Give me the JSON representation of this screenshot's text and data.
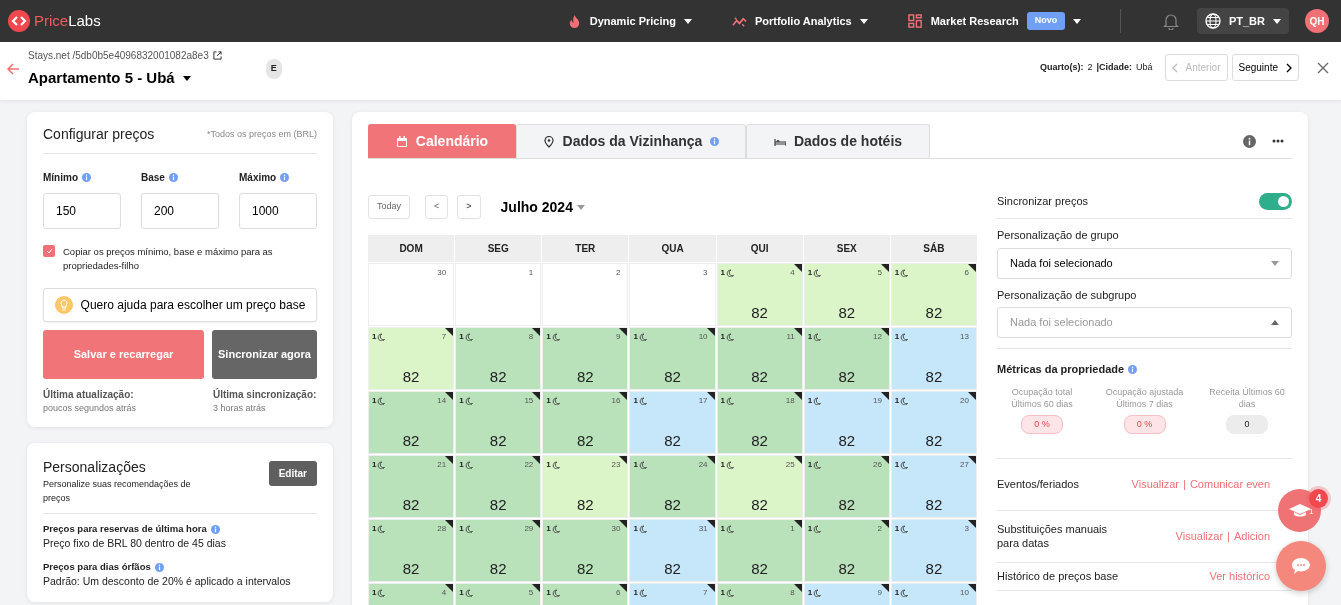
{
  "brand": {
    "accent": "Price",
    "rest": "Labs"
  },
  "nav": [
    {
      "label": "Dynamic Pricing"
    },
    {
      "label": "Portfolio Analytics"
    },
    {
      "label": "Market Research",
      "badge": "Novo"
    }
  ],
  "locale": "PT_BR",
  "avatar": "QH",
  "header": {
    "breadcrumb": "Stays.net /5db0b5e4096832001082a8e3",
    "title": "Apartamento 5 - Ubá",
    "tag": "E",
    "info": [
      {
        "label": "Quarto(s):",
        "value": "2"
      },
      {
        "label": "|Cidade:",
        "value": "Ubá"
      }
    ],
    "pager": [
      {
        "label": "Anterior",
        "disabled": true
      },
      {
        "label": "Seguinte",
        "disabled": false
      }
    ]
  },
  "prices": {
    "title": "Configurar preços",
    "note": "*Todos os preços em (BRL)",
    "fields": [
      {
        "label": "Mínimo",
        "value": "150"
      },
      {
        "label": "Base",
        "value": "200"
      },
      {
        "label": "Máximo",
        "value": "1000"
      }
    ],
    "copy": {
      "label": "Copiar os preços mínimo, base e máximo para as propriedades-filho",
      "checked": true
    },
    "help": "Quero ajuda para escolher um preço base",
    "save": "Salvar e recarregar",
    "sync": "Sincronizar agora",
    "statuses": [
      {
        "label": "Última atualização:",
        "value": "poucos segundos atrás"
      },
      {
        "label": "Última sincronização:",
        "value": "3 horas atrás"
      }
    ]
  },
  "custom": {
    "title": "Personalizações",
    "subtitle": "Personalize suas recomendações de preços",
    "edit": "Editar",
    "items": [
      {
        "label": "Preços para reservas de última hora",
        "value": "Preço fixo de BRL 80 dentro de 45 dias"
      },
      {
        "label": "Preços para dias órfãos",
        "value": "Padrão: Um desconto de 20% é aplicado a intervalos"
      }
    ]
  },
  "tabs": [
    {
      "label": "Calendário",
      "selected": true
    },
    {
      "label": "Dados da Vizinhança",
      "selected": false,
      "info": true
    },
    {
      "label": "Dados de hotéis",
      "selected": false
    }
  ],
  "calendar": {
    "today": "Today",
    "prev": "<",
    "next": ">",
    "month": "Julho 2024",
    "weekdays": [
      "DOM",
      "SEG",
      "TER",
      "QUA",
      "QUI",
      "SEX",
      "SÁB"
    ],
    "weeks": [
      [
        {
          "date": "30",
          "color": "#ffffff"
        },
        {
          "date": "1",
          "color": "#ffffff"
        },
        {
          "date": "2",
          "color": "#ffffff"
        },
        {
          "date": "3",
          "color": "#ffffff"
        },
        {
          "date": "4",
          "nights": "1",
          "price": "82",
          "color": "#dcf5c8",
          "flag": true
        },
        {
          "date": "5",
          "nights": "1",
          "price": "82",
          "color": "#dcf5c8",
          "flag": true
        },
        {
          "date": "6",
          "nights": "1",
          "price": "82",
          "color": "#dcf5c8",
          "flag": true
        }
      ],
      [
        {
          "date": "7",
          "nights": "1",
          "price": "82",
          "color": "#dcf5c8",
          "flag": true
        },
        {
          "date": "8",
          "nights": "1",
          "price": "82",
          "color": "#b9e2bb",
          "flag": true
        },
        {
          "date": "9",
          "nights": "1",
          "price": "82",
          "color": "#b9e2bb",
          "flag": true
        },
        {
          "date": "10",
          "nights": "1",
          "price": "82",
          "color": "#b9e2bb",
          "flag": true
        },
        {
          "date": "11",
          "nights": "1",
          "price": "82",
          "color": "#b9e2bb",
          "flag": true
        },
        {
          "date": "12",
          "nights": "1",
          "price": "82",
          "color": "#b9e2bb",
          "flag": true
        },
        {
          "date": "13",
          "nights": "1",
          "price": "82",
          "color": "#c6e6f9",
          "flag": false
        }
      ],
      [
        {
          "date": "14",
          "nights": "1",
          "price": "82",
          "color": "#b9e2bb",
          "flag": true
        },
        {
          "date": "15",
          "nights": "1",
          "price": "82",
          "color": "#b9e2bb",
          "flag": true
        },
        {
          "date": "16",
          "nights": "1",
          "price": "82",
          "color": "#b9e2bb",
          "flag": true
        },
        {
          "date": "17",
          "nights": "1",
          "price": "82",
          "color": "#c6e6f9",
          "flag": true
        },
        {
          "date": "18",
          "nights": "1",
          "price": "82",
          "color": "#b9e2bb",
          "flag": true
        },
        {
          "date": "19",
          "nights": "1",
          "price": "82",
          "color": "#c6e6f9",
          "flag": true
        },
        {
          "date": "20",
          "nights": "1",
          "price": "82",
          "color": "#c6e6f9",
          "flag": true
        }
      ],
      [
        {
          "date": "21",
          "nights": "1",
          "price": "82",
          "color": "#b9e2bb",
          "flag": true
        },
        {
          "date": "22",
          "nights": "1",
          "price": "82",
          "color": "#b9e2bb",
          "flag": true
        },
        {
          "date": "23",
          "nights": "1",
          "price": "82",
          "color": "#dcf5c8",
          "flag": true
        },
        {
          "date": "24",
          "nights": "1",
          "price": "82",
          "color": "#b9e2bb",
          "flag": true
        },
        {
          "date": "25",
          "nights": "1",
          "price": "82",
          "color": "#dcf5c8",
          "flag": true
        },
        {
          "date": "26",
          "nights": "1",
          "price": "82",
          "color": "#b9e2bb",
          "flag": true
        },
        {
          "date": "27",
          "nights": "1",
          "price": "82",
          "color": "#c6e6f9",
          "flag": true
        }
      ],
      [
        {
          "date": "28",
          "nights": "1",
          "price": "82",
          "color": "#b9e2bb",
          "flag": true
        },
        {
          "date": "29",
          "nights": "1",
          "price": "82",
          "color": "#b9e2bb",
          "flag": true
        },
        {
          "date": "30",
          "nights": "1",
          "price": "82",
          "color": "#b9e2bb",
          "flag": true
        },
        {
          "date": "31",
          "nights": "1",
          "price": "82",
          "color": "#c6e6f9",
          "flag": true
        },
        {
          "date": "1",
          "nights": "1",
          "price": "82",
          "color": "#b9e2bb",
          "flag": true
        },
        {
          "date": "2",
          "nights": "1",
          "price": "82",
          "color": "#b9e2bb",
          "flag": true
        },
        {
          "date": "3",
          "nights": "1",
          "price": "82",
          "color": "#c6e6f9",
          "flag": true
        }
      ],
      [
        {
          "date": "4",
          "nights": "1",
          "color": "#b9e2bb",
          "flag": true
        },
        {
          "date": "5",
          "nights": "1",
          "color": "#b9e2bb",
          "flag": true
        },
        {
          "date": "6",
          "nights": "1",
          "color": "#b9e2bb",
          "flag": true
        },
        {
          "date": "7",
          "nights": "1",
          "color": "#c6e6f9",
          "flag": true
        },
        {
          "date": "8",
          "nights": "1",
          "color": "#b9e2bb",
          "flag": true
        },
        {
          "date": "9",
          "nights": "1",
          "color": "#c6e6f9",
          "flag": true
        },
        {
          "date": "10",
          "nights": "1",
          "color": "#c6e6f9",
          "flag": true
        }
      ]
    ]
  },
  "side": {
    "sync": {
      "label": "Sincronizar preços",
      "on": true
    },
    "group": {
      "label": "Personalização de grupo",
      "value": "Nada foi selecionado"
    },
    "subgroup": {
      "label": "Personalização de subgrupo",
      "placeholder": "Nada foi selecionado"
    },
    "metrics": {
      "title": "Métricas da propriedade",
      "items": [
        {
          "label": "Ocupação total Últimos 60 dias",
          "value": "0 %",
          "kind": "alert"
        },
        {
          "label": "Ocupação ajustada Últimos 7 dias",
          "value": "0 %",
          "kind": "alert"
        },
        {
          "label": "Receita Últimos 60 dias",
          "value": "0",
          "kind": "plain"
        }
      ]
    },
    "rows": [
      {
        "label": "Eventos/feriados",
        "links": [
          "Visualizar",
          "Comunicar even"
        ],
        "separator": "|"
      },
      {
        "label": "Substituições manuais para datas",
        "links": [
          "Visualizar",
          "Adicion"
        ],
        "separator": "|"
      },
      {
        "label": "Histórico de preços base",
        "links": [
          "Ver histórico"
        ]
      }
    ]
  },
  "floating": {
    "count": "4",
    "small": "1"
  }
}
